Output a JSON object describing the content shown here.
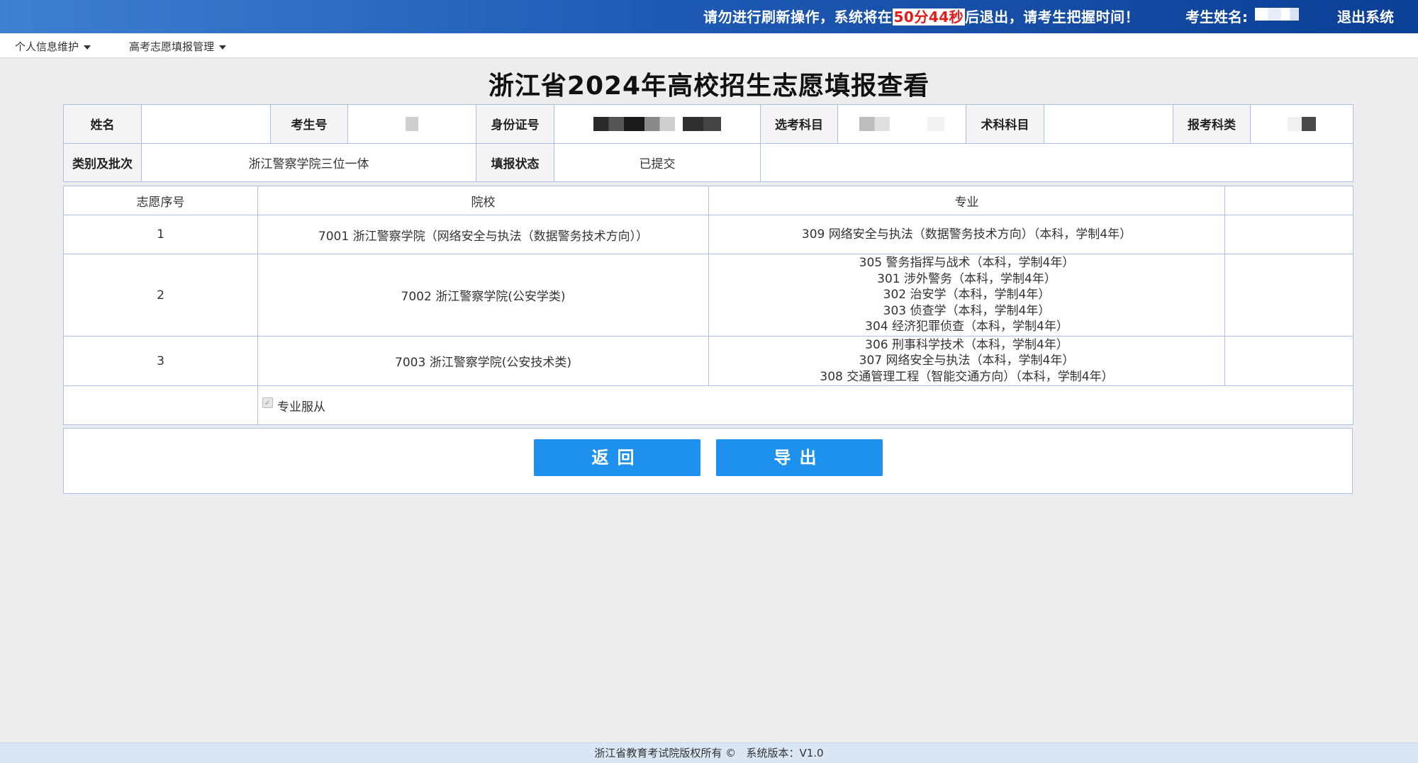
{
  "header": {
    "notice_before": "请勿进行刷新操作，系统将在",
    "countdown": "50分44秒",
    "notice_after": "后退出，请考生把握时间！",
    "name_label": "考生姓名:",
    "logout": "退出系统"
  },
  "menu": [
    {
      "label": "个人信息维护"
    },
    {
      "label": "高考志愿填报管理"
    }
  ],
  "title": "浙江省2024年高校招生志愿填报查看",
  "info": {
    "name_label": "姓名",
    "name_value": "",
    "exam_no_label": "考生号",
    "id_label": "身份证号",
    "subjects_label": "选考科目",
    "skill_label": "术科科目",
    "skill_value": "",
    "category_label": "报考科类",
    "batch_label": "类别及批次",
    "batch_value": "浙江警察学院三位一体",
    "status_label": "填报状态",
    "status_value": "已提交"
  },
  "wish_table": {
    "headers": [
      "志愿序号",
      "院校",
      "专业",
      ""
    ],
    "rows": [
      {
        "no": "1",
        "school": "7001 浙江警察学院（网络安全与执法（数据警务技术方向））",
        "majors": [
          "309 网络安全与执法（数据警务技术方向）（本科，学制4年）"
        ]
      },
      {
        "no": "2",
        "school": "7002 浙江警察学院(公安学类)",
        "majors": [
          "305 警务指挥与战术（本科，学制4年）",
          "301 涉外警务（本科，学制4年）",
          "302 治安学（本科，学制4年）",
          "303 侦查学（本科，学制4年）",
          "304 经济犯罪侦查（本科，学制4年）"
        ]
      },
      {
        "no": "3",
        "school": "7003 浙江警察学院(公安技术类)",
        "majors": [
          "306 刑事科学技术（本科，学制4年）",
          "307 网络安全与执法（本科，学制4年）",
          "308 交通管理工程（智能交通方向）（本科，学制4年）"
        ]
      }
    ],
    "obey_label": "专业服从",
    "obey_checked": true
  },
  "buttons": {
    "back": "返回",
    "export": "导出"
  },
  "footer": {
    "copyright": "浙江省教育考试院版权所有 ©",
    "version": "系统版本：V1.0"
  },
  "colors": {
    "accent": "#1e90ee",
    "countdown": "#e21b1b",
    "border": "#a9c1e3"
  }
}
